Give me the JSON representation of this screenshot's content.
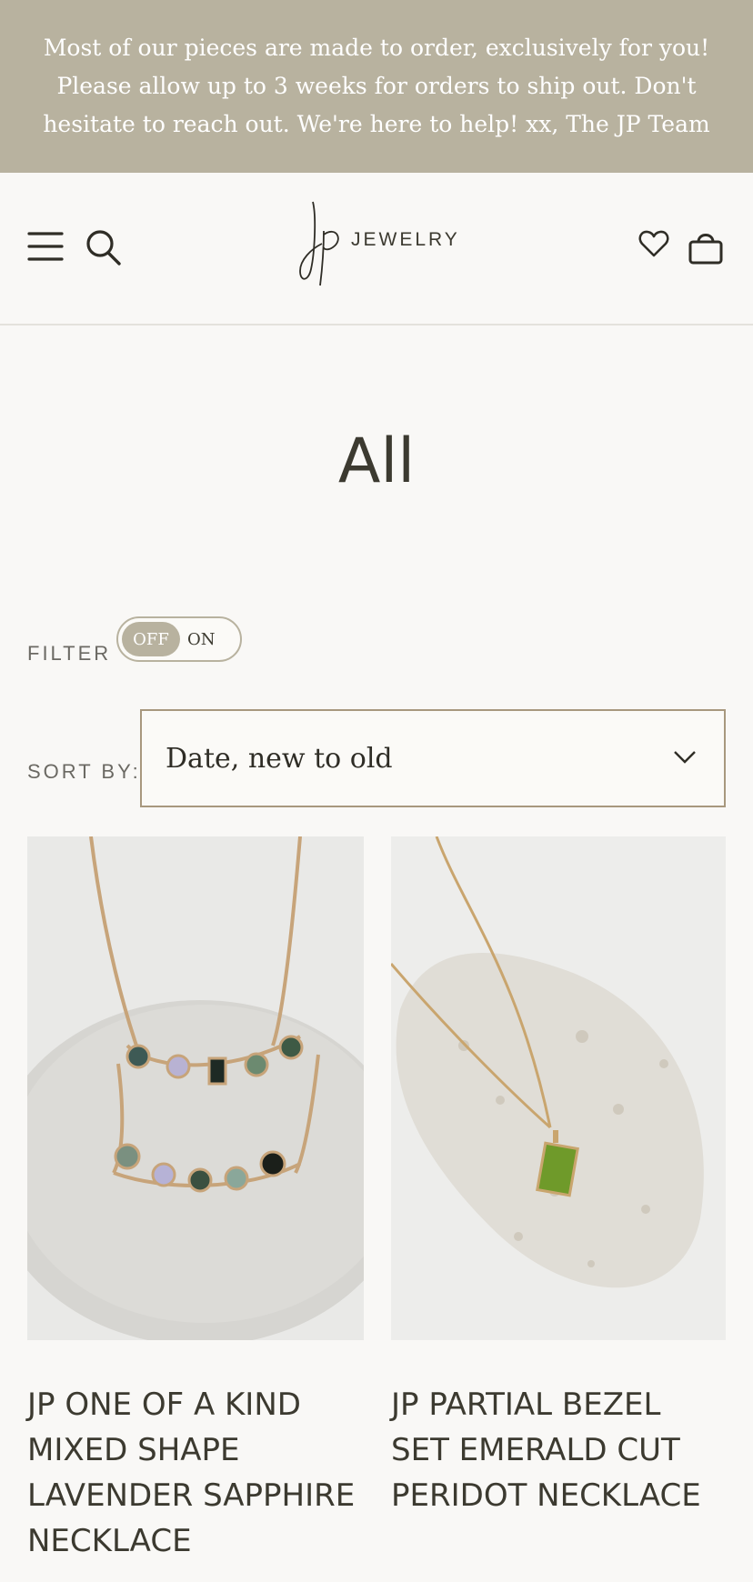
{
  "announcement": {
    "text": "Most of our pieces are made to order, exclusively for you! Please allow up to 3 weeks for orders to ship out. Don't hesitate to reach out. We're here to help! xx, The JP Team"
  },
  "header": {
    "logo_text": "JEWELRY",
    "icons": [
      "menu-icon",
      "search-icon",
      "heart-icon",
      "bag-icon"
    ]
  },
  "page": {
    "title": "All"
  },
  "filter": {
    "label": "FILTER",
    "off_label": "OFF",
    "on_label": "ON",
    "state": "off"
  },
  "sort": {
    "label": "SORT BY:",
    "selected": "Date, new to old"
  },
  "products": [
    {
      "title": "JP ONE OF A KIND MIXED SHAPE LAVENDER SAPPHIRE NECKLACE"
    },
    {
      "title": "JP PARTIAL BEZEL SET EMERALD CUT PERIDOT NECKLACE"
    }
  ],
  "colors": {
    "announcement_bg": "#b8b29f",
    "accent": "#b8b29f",
    "text": "#3c3a30",
    "page_bg": "#f9f8f6"
  }
}
